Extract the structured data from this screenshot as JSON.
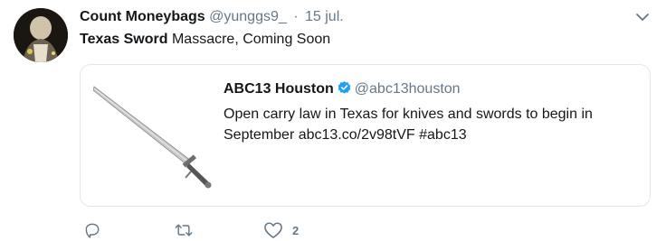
{
  "tweet": {
    "author_name": "Count Moneybags",
    "author_handle": "@yunggs9_",
    "separator": "·",
    "timestamp": "15 jul.",
    "text_bold": "Texas Sword",
    "text_rest": " Massacre, Coming Soon"
  },
  "quoted": {
    "author_name": "ABC13 Houston",
    "author_handle": "@abc13houston",
    "text": "Open carry law in Texas for knives and swords to begin in September abc13.co/2v98tVF #abc13"
  },
  "actions": {
    "like_count": "2"
  },
  "icons": {
    "menu": "chevron-down-icon",
    "verified": "verified-badge-icon",
    "reply": "reply-icon",
    "retweet": "retweet-icon",
    "like": "heart-icon"
  },
  "colors": {
    "accent": "#1da1f2",
    "secondary_text": "#657786",
    "border": "#e1e8ed"
  }
}
